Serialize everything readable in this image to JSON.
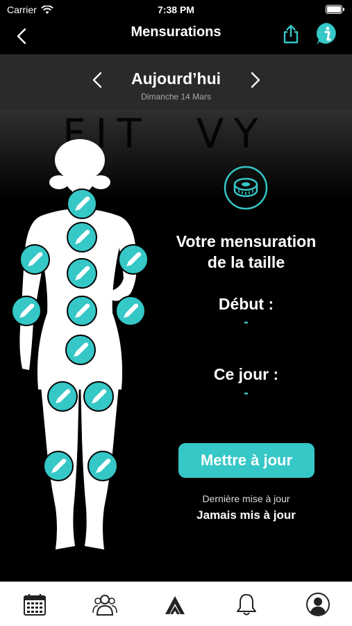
{
  "status_bar": {
    "carrier": "Carrier",
    "time": "7:38 PM"
  },
  "nav": {
    "title": "Mensurations"
  },
  "date": {
    "day": "Aujourd’hui",
    "full_date": "Dimanche 14 Mars"
  },
  "hero": {
    "watermark": "FIT  VY"
  },
  "measurement": {
    "heading_line1": "Votre mensuration",
    "heading_line2": "de la taille",
    "start_label": "Début :",
    "start_value": "-",
    "today_label": "Ce jour :",
    "today_value": "-"
  },
  "actions": {
    "update_label": "Mettre à jour"
  },
  "last_update": {
    "label": "Dernière mise à jour",
    "value": "Jamais mis à jour"
  },
  "tabs": [
    {
      "name": "calendar-icon"
    },
    {
      "name": "users-icon"
    },
    {
      "name": "fitvy-logo-icon"
    },
    {
      "name": "bell-icon"
    },
    {
      "name": "profile-icon"
    }
  ],
  "colors": {
    "accent": "#36c7c7",
    "background": "#000000",
    "banner": "#2a2a2a",
    "tab_bar": "#ffffff"
  }
}
